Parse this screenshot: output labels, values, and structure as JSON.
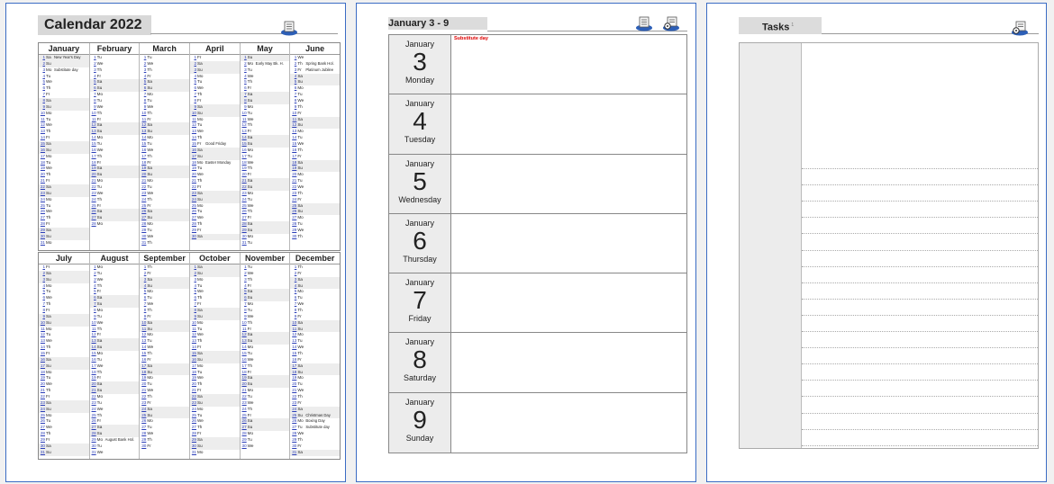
{
  "year_page": {
    "title": "Calendar 2022",
    "months": [
      {
        "name": "January",
        "start": 6,
        "days": 31,
        "hol": {
          "1": "New Year's Day",
          "3": "Substitute day"
        }
      },
      {
        "name": "February",
        "start": 2,
        "days": 28,
        "hol": {}
      },
      {
        "name": "March",
        "start": 2,
        "days": 31,
        "hol": {}
      },
      {
        "name": "April",
        "start": 5,
        "days": 30,
        "hol": {
          "15": "Good Friday",
          "18": "Easter Monday"
        }
      },
      {
        "name": "May",
        "start": 0,
        "days": 31,
        "hol": {
          "2": "Early May Bk. H.",
          "29": ""
        }
      },
      {
        "name": "June",
        "start": 3,
        "days": 30,
        "hol": {
          "2": "Spring Bank Hol.",
          "3": "Platinum Jubilee"
        }
      },
      {
        "name": "July",
        "start": 5,
        "days": 31,
        "hol": {}
      },
      {
        "name": "August",
        "start": 1,
        "days": 31,
        "hol": {
          "29": "August Bank Hol."
        }
      },
      {
        "name": "September",
        "start": 4,
        "days": 30,
        "hol": {}
      },
      {
        "name": "October",
        "start": 6,
        "days": 31,
        "hol": {}
      },
      {
        "name": "November",
        "start": 2,
        "days": 30,
        "hol": {}
      },
      {
        "name": "December",
        "start": 4,
        "days": 31,
        "hol": {
          "25": "Christmas Day",
          "26": "Boxing Day",
          "27": "Substitute day"
        }
      }
    ],
    "weekday_abbr": [
      "Su",
      "Mo",
      "Tu",
      "We",
      "Th",
      "Fr",
      "Sa"
    ]
  },
  "week_page": {
    "title": "January 3 - 9",
    "days": [
      {
        "month": "January",
        "num": "3",
        "name": "Monday",
        "note": "Substitute day"
      },
      {
        "month": "January",
        "num": "4",
        "name": "Tuesday",
        "note": ""
      },
      {
        "month": "January",
        "num": "5",
        "name": "Wednesday",
        "note": ""
      },
      {
        "month": "January",
        "num": "6",
        "name": "Thursday",
        "note": ""
      },
      {
        "month": "January",
        "num": "7",
        "name": "Friday",
        "note": ""
      },
      {
        "month": "January",
        "num": "8",
        "name": "Saturday",
        "note": ""
      },
      {
        "month": "January",
        "num": "9",
        "name": "Sunday",
        "note": ""
      }
    ]
  },
  "tasks_page": {
    "title": "Tasks",
    "title_sup": "1"
  },
  "colors": {
    "page_border": "#3b6cc4",
    "title_bg": "#d8d8d8",
    "holiday_red": "#dd0000",
    "day_link": "#2a3db8"
  }
}
